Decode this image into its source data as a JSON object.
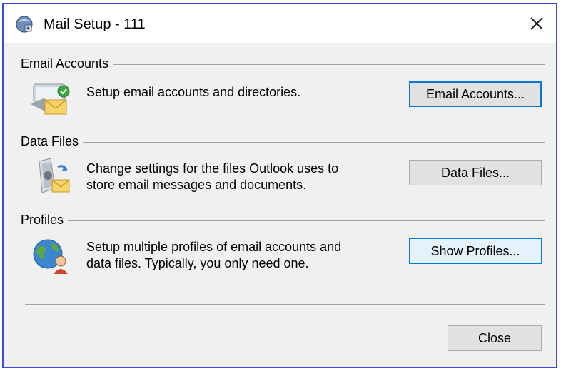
{
  "window": {
    "title": "Mail Setup - 111",
    "border_color": "#3b4bd8",
    "background": "#f0f0f0"
  },
  "icons": {
    "title": "mail-setup-icon",
    "close": "close-icon",
    "email_accounts": "email-accounts-icon",
    "data_files": "data-files-icon",
    "profiles": "profiles-icon"
  },
  "sections": {
    "email_accounts": {
      "header": "Email Accounts",
      "description": "Setup email accounts and directories.",
      "button_label": "Email Accounts..."
    },
    "data_files": {
      "header": "Data Files",
      "description": "Change settings for the files Outlook uses to\nstore email messages and documents.",
      "button_label": "Data Files..."
    },
    "profiles": {
      "header": "Profiles",
      "description": "Setup multiple profiles of email accounts and\ndata files. Typically, you only need one.",
      "button_label": "Show Profiles..."
    }
  },
  "footer": {
    "close_label": "Close"
  },
  "colors": {
    "focus_accent": "#0078d7",
    "button_face": "#e1e1e1"
  }
}
